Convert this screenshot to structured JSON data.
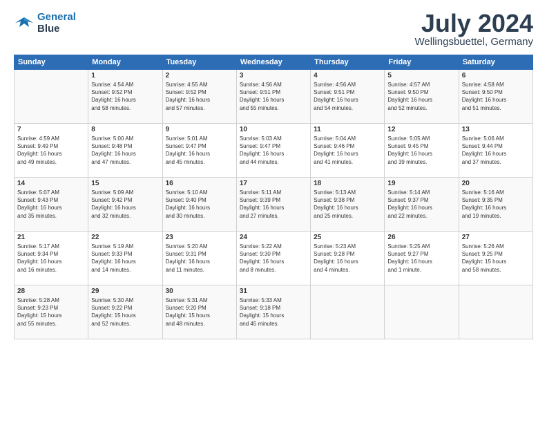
{
  "header": {
    "logo_line1": "General",
    "logo_line2": "Blue",
    "month": "July 2024",
    "location": "Wellingsbuettel, Germany"
  },
  "days_of_week": [
    "Sunday",
    "Monday",
    "Tuesday",
    "Wednesday",
    "Thursday",
    "Friday",
    "Saturday"
  ],
  "weeks": [
    [
      {
        "day": "",
        "content": ""
      },
      {
        "day": "1",
        "content": "Sunrise: 4:54 AM\nSunset: 9:52 PM\nDaylight: 16 hours\nand 58 minutes."
      },
      {
        "day": "2",
        "content": "Sunrise: 4:55 AM\nSunset: 9:52 PM\nDaylight: 16 hours\nand 57 minutes."
      },
      {
        "day": "3",
        "content": "Sunrise: 4:56 AM\nSunset: 9:51 PM\nDaylight: 16 hours\nand 55 minutes."
      },
      {
        "day": "4",
        "content": "Sunrise: 4:56 AM\nSunset: 9:51 PM\nDaylight: 16 hours\nand 54 minutes."
      },
      {
        "day": "5",
        "content": "Sunrise: 4:57 AM\nSunset: 9:50 PM\nDaylight: 16 hours\nand 52 minutes."
      },
      {
        "day": "6",
        "content": "Sunrise: 4:58 AM\nSunset: 9:50 PM\nDaylight: 16 hours\nand 51 minutes."
      }
    ],
    [
      {
        "day": "7",
        "content": "Sunrise: 4:59 AM\nSunset: 9:49 PM\nDaylight: 16 hours\nand 49 minutes."
      },
      {
        "day": "8",
        "content": "Sunrise: 5:00 AM\nSunset: 9:48 PM\nDaylight: 16 hours\nand 47 minutes."
      },
      {
        "day": "9",
        "content": "Sunrise: 5:01 AM\nSunset: 9:47 PM\nDaylight: 16 hours\nand 45 minutes."
      },
      {
        "day": "10",
        "content": "Sunrise: 5:03 AM\nSunset: 9:47 PM\nDaylight: 16 hours\nand 44 minutes."
      },
      {
        "day": "11",
        "content": "Sunrise: 5:04 AM\nSunset: 9:46 PM\nDaylight: 16 hours\nand 41 minutes."
      },
      {
        "day": "12",
        "content": "Sunrise: 5:05 AM\nSunset: 9:45 PM\nDaylight: 16 hours\nand 39 minutes."
      },
      {
        "day": "13",
        "content": "Sunrise: 5:06 AM\nSunset: 9:44 PM\nDaylight: 16 hours\nand 37 minutes."
      }
    ],
    [
      {
        "day": "14",
        "content": "Sunrise: 5:07 AM\nSunset: 9:43 PM\nDaylight: 16 hours\nand 35 minutes."
      },
      {
        "day": "15",
        "content": "Sunrise: 5:09 AM\nSunset: 9:42 PM\nDaylight: 16 hours\nand 32 minutes."
      },
      {
        "day": "16",
        "content": "Sunrise: 5:10 AM\nSunset: 9:40 PM\nDaylight: 16 hours\nand 30 minutes."
      },
      {
        "day": "17",
        "content": "Sunrise: 5:11 AM\nSunset: 9:39 PM\nDaylight: 16 hours\nand 27 minutes."
      },
      {
        "day": "18",
        "content": "Sunrise: 5:13 AM\nSunset: 9:38 PM\nDaylight: 16 hours\nand 25 minutes."
      },
      {
        "day": "19",
        "content": "Sunrise: 5:14 AM\nSunset: 9:37 PM\nDaylight: 16 hours\nand 22 minutes."
      },
      {
        "day": "20",
        "content": "Sunrise: 5:16 AM\nSunset: 9:35 PM\nDaylight: 16 hours\nand 19 minutes."
      }
    ],
    [
      {
        "day": "21",
        "content": "Sunrise: 5:17 AM\nSunset: 9:34 PM\nDaylight: 16 hours\nand 16 minutes."
      },
      {
        "day": "22",
        "content": "Sunrise: 5:19 AM\nSunset: 9:33 PM\nDaylight: 16 hours\nand 14 minutes."
      },
      {
        "day": "23",
        "content": "Sunrise: 5:20 AM\nSunset: 9:31 PM\nDaylight: 16 hours\nand 11 minutes."
      },
      {
        "day": "24",
        "content": "Sunrise: 5:22 AM\nSunset: 9:30 PM\nDaylight: 16 hours\nand 8 minutes."
      },
      {
        "day": "25",
        "content": "Sunrise: 5:23 AM\nSunset: 9:28 PM\nDaylight: 16 hours\nand 4 minutes."
      },
      {
        "day": "26",
        "content": "Sunrise: 5:25 AM\nSunset: 9:27 PM\nDaylight: 16 hours\nand 1 minute."
      },
      {
        "day": "27",
        "content": "Sunrise: 5:26 AM\nSunset: 9:25 PM\nDaylight: 15 hours\nand 58 minutes."
      }
    ],
    [
      {
        "day": "28",
        "content": "Sunrise: 5:28 AM\nSunset: 9:23 PM\nDaylight: 15 hours\nand 55 minutes."
      },
      {
        "day": "29",
        "content": "Sunrise: 5:30 AM\nSunset: 9:22 PM\nDaylight: 15 hours\nand 52 minutes."
      },
      {
        "day": "30",
        "content": "Sunrise: 5:31 AM\nSunset: 9:20 PM\nDaylight: 15 hours\nand 48 minutes."
      },
      {
        "day": "31",
        "content": "Sunrise: 5:33 AM\nSunset: 9:18 PM\nDaylight: 15 hours\nand 45 minutes."
      },
      {
        "day": "",
        "content": ""
      },
      {
        "day": "",
        "content": ""
      },
      {
        "day": "",
        "content": ""
      }
    ]
  ]
}
